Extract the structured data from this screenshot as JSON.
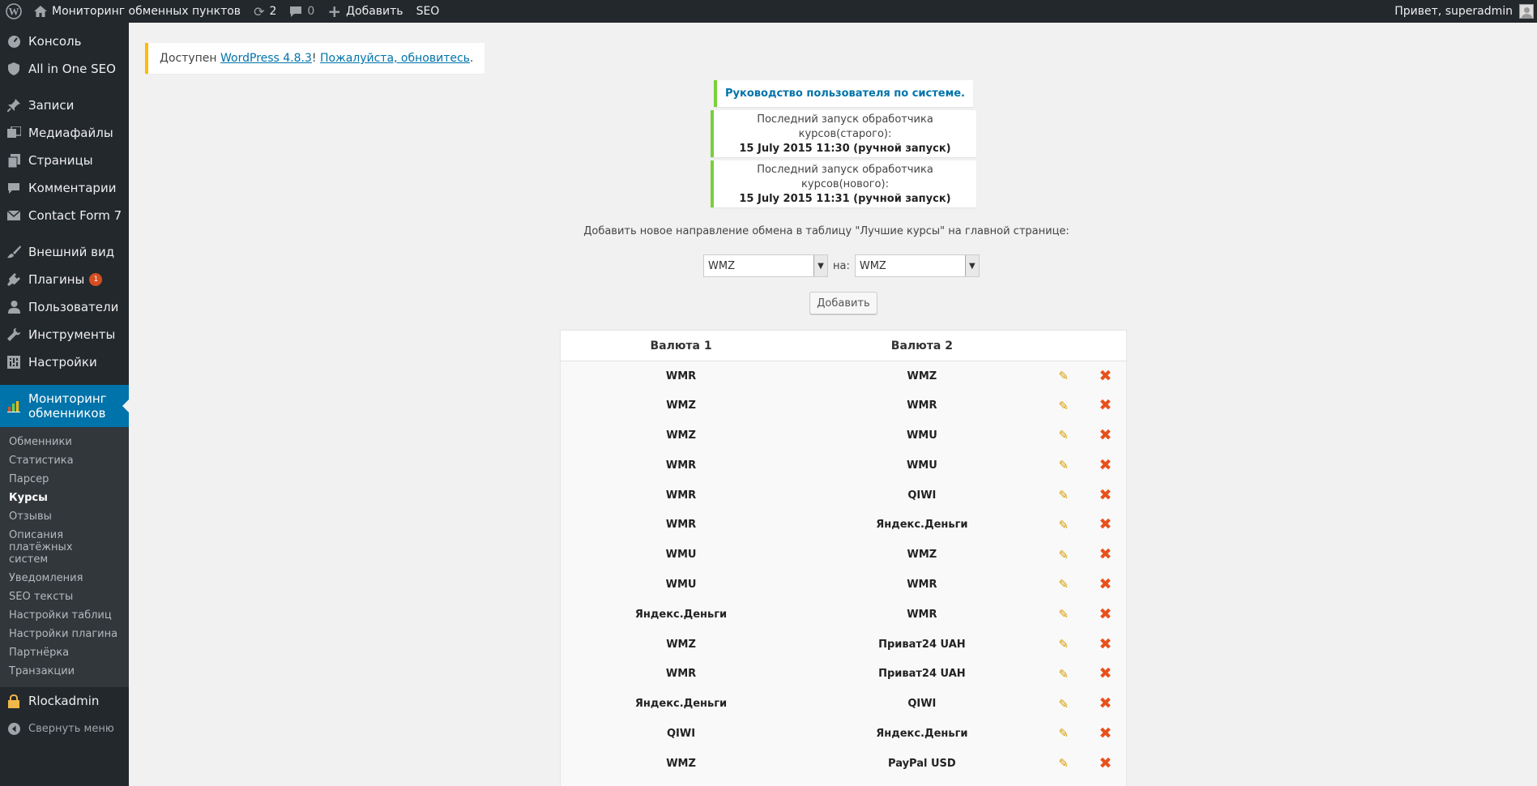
{
  "adminbar": {
    "site_name": "Мониторинг обменных пунктов",
    "updates_count": "2",
    "comments_count": "0",
    "add_label": "Добавить",
    "seo_label": "SEO",
    "greeting": "Привет, superadmin"
  },
  "sidebar": {
    "items": [
      {
        "label": "Консоль",
        "icon": "dashboard-icon"
      },
      {
        "label": "All in One SEO",
        "icon": "shield-icon"
      },
      {
        "label": "Записи",
        "icon": "pin-icon"
      },
      {
        "label": "Медиафайлы",
        "icon": "media-icon"
      },
      {
        "label": "Страницы",
        "icon": "pages-icon"
      },
      {
        "label": "Комментарии",
        "icon": "comment-icon"
      },
      {
        "label": "Contact Form 7",
        "icon": "mail-icon"
      },
      {
        "label": "Внешний вид",
        "icon": "brush-icon"
      },
      {
        "label": "Плагины",
        "icon": "plugin-icon",
        "badge": "1"
      },
      {
        "label": "Пользователи",
        "icon": "user-icon"
      },
      {
        "label": "Инструменты",
        "icon": "wrench-icon"
      },
      {
        "label": "Настройки",
        "icon": "settings-icon"
      }
    ],
    "current": {
      "label_line1": "Мониторинг",
      "label_line2": "обменников",
      "icon": "chart-icon"
    },
    "submenu": [
      "Обменники",
      "Статистика",
      "Парсер",
      "Курсы",
      "Отзывы",
      "Описания платёжных систем",
      "Уведомления",
      "SEO тексты",
      "Настройки таблиц",
      "Настройки плагина",
      "Партнёрка",
      "Транзакции"
    ],
    "submenu_active": "Курсы",
    "extra": {
      "label": "Rlockadmin",
      "icon": "lock-icon"
    },
    "collapse_label": "Свернуть меню"
  },
  "update_nag": {
    "prefix": "Доступен ",
    "version_link": "WordPress 4.8.3",
    "middle": "! ",
    "update_link": "Пожалуйста, обновитесь",
    "suffix": "."
  },
  "notices": {
    "guide_link": "Руководство пользователя по системе.",
    "old_run_line1": "Последний запуск обработчика",
    "old_run_line2": "курсов(старого):",
    "old_run_time": "15 July 2015 11:30 (ручной запуск)",
    "new_run_line1": "Последний запуск обработчика",
    "new_run_line2": "курсов(нового):",
    "new_run_time": "15 July 2015 11:31 (ручной запуск)"
  },
  "form": {
    "label": "Добавить новое направление обмена в таблицу \"Лучшие курсы\" на главной странице:",
    "from_value": "WMZ",
    "to_label": "на:",
    "to_value": "WMZ",
    "add_button": "Добавить"
  },
  "table": {
    "headers": [
      "Валюта 1",
      "Валюта 2"
    ],
    "rows": [
      [
        "WMR",
        "WMZ"
      ],
      [
        "WMZ",
        "WMR"
      ],
      [
        "WMZ",
        "WMU"
      ],
      [
        "WMR",
        "WMU"
      ],
      [
        "WMR",
        "QIWI"
      ],
      [
        "WMR",
        "Яндекс.Деньги"
      ],
      [
        "WMU",
        "WMZ"
      ],
      [
        "WMU",
        "WMR"
      ],
      [
        "Яндекс.Деньги",
        "WMR"
      ],
      [
        "WMZ",
        "Приват24 UAH"
      ],
      [
        "WMR",
        "Приват24 UAH"
      ],
      [
        "Яндекс.Деньги",
        "QIWI"
      ],
      [
        "QIWI",
        "Яндекс.Деньги"
      ],
      [
        "WMZ",
        "PayPal USD"
      ],
      [
        "",
        ""
      ]
    ]
  }
}
